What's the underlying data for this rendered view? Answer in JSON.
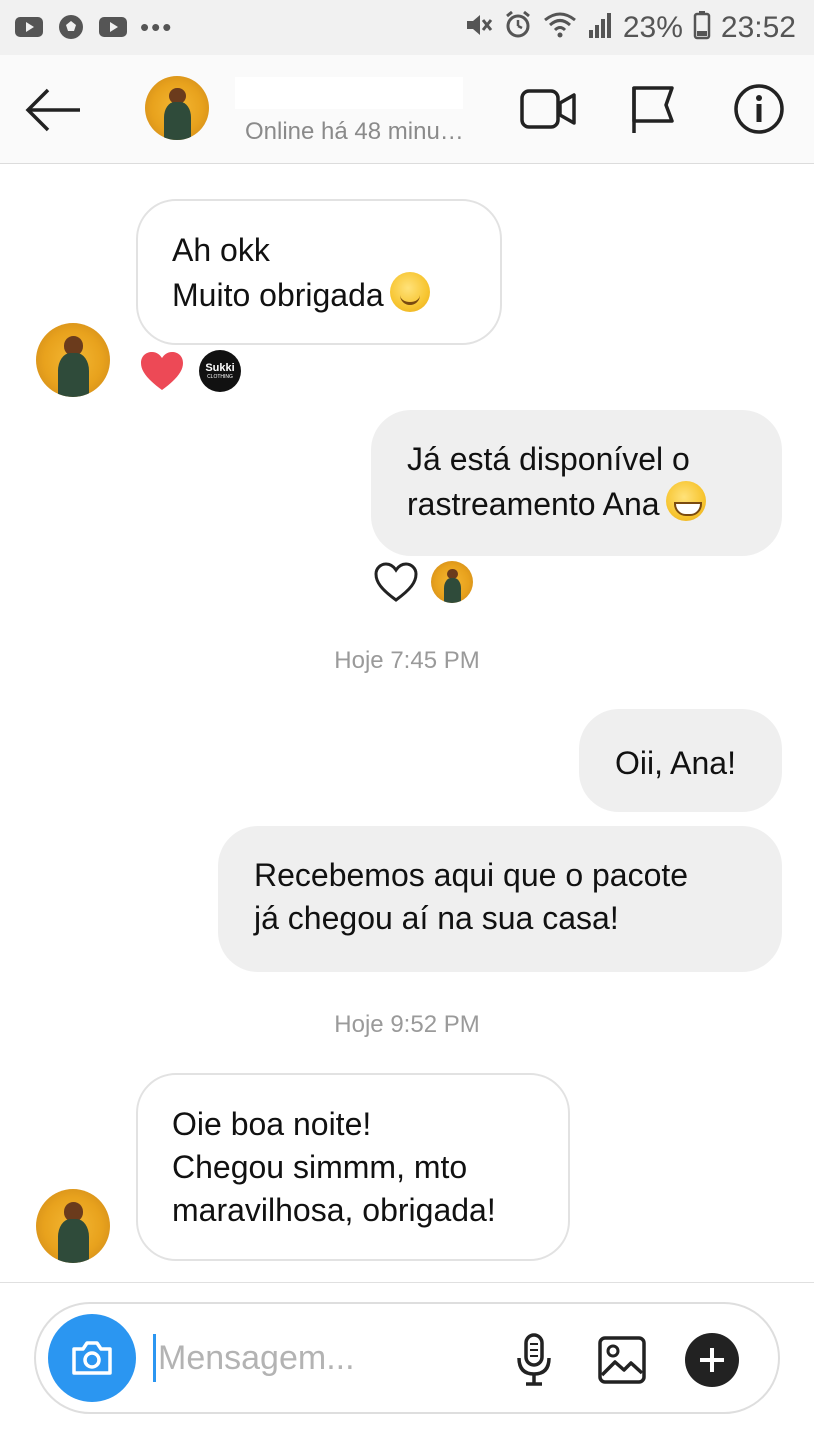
{
  "status_bar": {
    "battery_percent": "23%",
    "time": "23:52",
    "overflow": "•••"
  },
  "header": {
    "contact_status": "Online há 48 minu…"
  },
  "messages": [
    {
      "lines": [
        "Ah okk",
        "Muito obrigada"
      ],
      "reactions": [
        "heart",
        "sukki"
      ]
    },
    {
      "lines": [
        "Já está disponível o",
        "rastreamento Ana"
      ],
      "reactions": [
        "heart-outline",
        "avatar"
      ]
    },
    {
      "lines": [
        "Oii, Ana!"
      ]
    },
    {
      "lines": [
        "Recebemos aqui que o pacote",
        "já chegou aí na sua casa!"
      ]
    },
    {
      "lines": [
        "Oie boa noite!",
        "Chegou simmm, mto",
        "maravilhosa, obrigada!"
      ]
    }
  ],
  "timestamps": [
    "Hoje 7:45 PM",
    "Hoje 9:52 PM"
  ],
  "reaction_badge": {
    "line1": "Sukki",
    "line2": "CLOTHING"
  },
  "composer": {
    "placeholder": "Mensagem..."
  },
  "colors": {
    "accent": "#2b96f1",
    "heart": "#ed4956",
    "outgoing_bubble": "#efefef",
    "incoming_border": "#e2e2e2"
  }
}
